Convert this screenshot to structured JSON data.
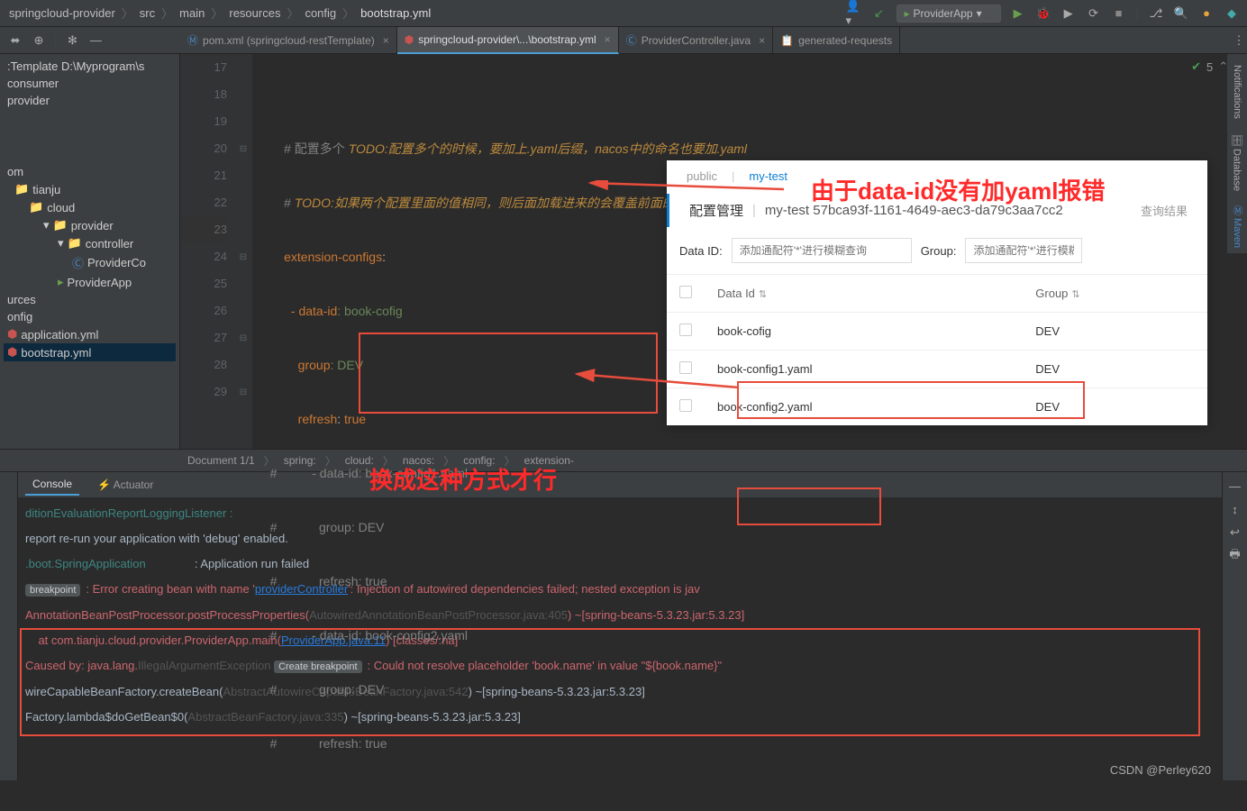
{
  "breadcrumb": [
    "springcloud-provider",
    "src",
    "main",
    "resources",
    "config",
    "bootstrap.yml"
  ],
  "run_config": "ProviderApp",
  "editor_tabs": [
    {
      "label": "pom.xml (springcloud-restTemplate)",
      "active": false
    },
    {
      "label": "springcloud-provider\\...\\bootstrap.yml",
      "active": true
    },
    {
      "label": "ProviderController.java",
      "active": false
    },
    {
      "label": "generated-requests",
      "active": false
    }
  ],
  "tree": {
    "root": ":Template  D:\\Myprogram\\s",
    "items": [
      "consumer",
      "provider"
    ],
    "items2": [
      "om",
      "tianju",
      "cloud",
      "provider",
      "controller",
      "ProviderCo",
      "ProviderApp",
      "urces",
      "onfig",
      "application.yml",
      "bootstrap.yml"
    ]
  },
  "gutter": [
    "17",
    "18",
    "19",
    "20",
    "21",
    "22",
    "23",
    "24",
    "25",
    "26",
    "27",
    "28",
    "29"
  ],
  "code": {
    "l17": "",
    "l18_c": "# 配置多个 ",
    "l18_todo": "TODO:配置多个的时候，要加上.yaml后缀，nacos中的命名也要加.yaml",
    "l19_c": "# ",
    "l19_todo": "TODO:如果两个配置里面的值相同，则后面加载进来的会覆盖前面的；",
    "l20_k": "extension-configs",
    "l20_v": ":",
    "l21_k": "  - data-id",
    "l21_v": ": book-cofig",
    "l22_k": "    group",
    "l22_v": ": DEV",
    "l23_k": "    refresh",
    "l23_v": ": ",
    "l23_t": "true",
    "l24": "#          - data-id: book-config1.yaml",
    "l25": "#            group: DEV",
    "l26": "#            refresh: true",
    "l27": "#          - data-id: book-config2.yaml",
    "l28": "#            group: DEV",
    "l29": "#            refresh: true"
  },
  "crumbs": [
    "Document 1/1",
    "spring:",
    "cloud:",
    "nacos:",
    "config:",
    "extension-"
  ],
  "console_tabs": [
    "Console",
    "Actuator"
  ],
  "console": {
    "l1": "ditionEvaluationReportLoggingListener :",
    "l2": "",
    "l3": "report re-run your application with 'debug' enabled.",
    "l4a": ".boot.SpringApplication",
    "l4b": "               : Application run failed",
    "l5": "",
    "bp1": "breakpoint",
    "bp2": "Create breakpoint",
    "l6a": ": Error creating bean with name '",
    "l6b": "providerController",
    "l6c": "': Injection of autowired dependencies failed; nested exception is jav",
    "l7a": "AnnotationBeanPostProcessor.postProcessProperties(",
    "l7b": "AutowiredAnnotationBeanPostProcessor.java:405",
    "l7c": ") ~[spring-beans-5.3.23.jar:5.3.23]",
    "l8a": "    at com.tianju.cloud.provider.ProviderApp.main(",
    "l8b": "ProviderApp.java:11",
    "l8c": ") [classes/:na]",
    "l9a": "Caused by: java.lang.",
    "l9b": "IllegalArgumentException",
    "l9c": ": Could not resolve placeholder 'book.name' in value \"${book.name}\"",
    "l10a": "wireCapableBeanFactory.createBean(",
    "l10b": "AbstractAutowireCapableBeanFactory.java:542",
    "l10c": ") ~[spring-beans-5.3.23.jar:5.3.23]",
    "l11a": "Factory.lambda$doGetBean$0(",
    "l11b": "AbstractBeanFactory.java:335",
    "l11c": ") ~[spring-beans-5.3.23.jar:5.3.23]"
  },
  "panel": {
    "tab_public": "public",
    "tab_mytest": "my-test",
    "title": "配置管理",
    "title_sep": "|",
    "title_sub": "my-test  57bca93f-1161-4649-aec3-da79c3aa7cc2",
    "title_right": "查询结果",
    "search_dataid": "Data ID:",
    "search_ph1": "添加通配符'*'进行模糊查询",
    "search_group": "Group:",
    "search_ph2": "添加通配符'*'进行模糊",
    "th_dataid": "Data Id",
    "th_group": "Group",
    "rows": [
      {
        "dataid": "book-cofig",
        "group": "DEV"
      },
      {
        "dataid": "book-config1.yaml",
        "group": "DEV"
      },
      {
        "dataid": "book-config2.yaml",
        "group": "DEV"
      }
    ]
  },
  "anno": {
    "red1": "由于data-id没有加yaml报错",
    "red2": "换成这种方式才行"
  },
  "watermark": "CSDN @Perley620",
  "status_count": "5"
}
